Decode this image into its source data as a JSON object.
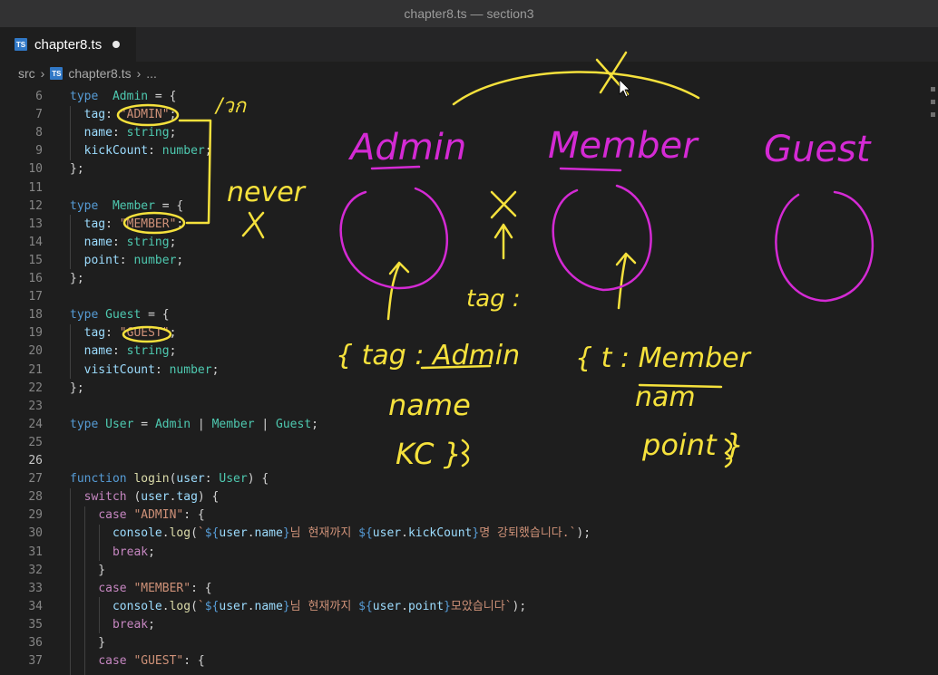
{
  "window": {
    "title": "chapter8.ts — section3"
  },
  "tab": {
    "badge": "TS",
    "label": "chapter8.ts"
  },
  "breadcrumb": {
    "folder": "src",
    "badge": "TS",
    "file": "chapter8.ts",
    "more": "..."
  },
  "colors": {
    "keyword": "#569cd6",
    "control": "#c586c0",
    "type": "#4ec9b0",
    "property": "#9cdcfe",
    "string": "#ce9178",
    "function": "#dcdcaa",
    "annotation_yellow": "#f5e13c",
    "annotation_magenta": "#d42ad4",
    "ts_badge": "#3178c6"
  },
  "annotations": {
    "labels": [
      "Admin",
      "Member",
      "Guest"
    ],
    "notes": [
      "/วก",
      "never",
      "X",
      "X",
      "tag :",
      "{ tag : Admin",
      "name",
      "KC }",
      "{ t : Member",
      "nam",
      "point }"
    ]
  },
  "code": {
    "lines": [
      {
        "no": "6",
        "tokens": [
          [
            "kw",
            "type"
          ],
          [
            "",
            "  "
          ],
          [
            "tp",
            "Admin"
          ],
          [
            "",
            " = {"
          ]
        ]
      },
      {
        "no": "7",
        "tokens": [
          [
            "",
            "  "
          ],
          [
            "pr",
            "tag"
          ],
          [
            "",
            ": "
          ],
          [
            "st",
            "\"ADMIN\""
          ],
          [
            "",
            ";"
          ]
        ]
      },
      {
        "no": "8",
        "tokens": [
          [
            "",
            "  "
          ],
          [
            "pr",
            "name"
          ],
          [
            "",
            ": "
          ],
          [
            "tp",
            "string"
          ],
          [
            "",
            ";"
          ]
        ]
      },
      {
        "no": "9",
        "tokens": [
          [
            "",
            "  "
          ],
          [
            "pr",
            "kickCount"
          ],
          [
            "",
            ": "
          ],
          [
            "tp",
            "number"
          ],
          [
            "",
            ";"
          ]
        ]
      },
      {
        "no": "10",
        "tokens": [
          [
            "",
            "};"
          ]
        ]
      },
      {
        "no": "11",
        "tokens": []
      },
      {
        "no": "12",
        "tokens": [
          [
            "kw",
            "type"
          ],
          [
            "",
            "  "
          ],
          [
            "tp",
            "Member"
          ],
          [
            "",
            " = {"
          ]
        ]
      },
      {
        "no": "13",
        "tokens": [
          [
            "",
            "  "
          ],
          [
            "pr",
            "tag"
          ],
          [
            "",
            ": "
          ],
          [
            "st",
            "\"MEMBER\""
          ],
          [
            "",
            ";"
          ]
        ]
      },
      {
        "no": "14",
        "tokens": [
          [
            "",
            "  "
          ],
          [
            "pr",
            "name"
          ],
          [
            "",
            ": "
          ],
          [
            "tp",
            "string"
          ],
          [
            "",
            ";"
          ]
        ]
      },
      {
        "no": "15",
        "tokens": [
          [
            "",
            "  "
          ],
          [
            "pr",
            "point"
          ],
          [
            "",
            ": "
          ],
          [
            "tp",
            "number"
          ],
          [
            "",
            ";"
          ]
        ]
      },
      {
        "no": "16",
        "tokens": [
          [
            "",
            "};"
          ]
        ]
      },
      {
        "no": "17",
        "tokens": []
      },
      {
        "no": "18",
        "tokens": [
          [
            "kw",
            "type"
          ],
          [
            "",
            " "
          ],
          [
            "tp",
            "Guest"
          ],
          [
            "",
            " = {"
          ]
        ]
      },
      {
        "no": "19",
        "tokens": [
          [
            "",
            "  "
          ],
          [
            "pr",
            "tag"
          ],
          [
            "",
            ": "
          ],
          [
            "st",
            "\"GUEST\""
          ],
          [
            "",
            ";"
          ]
        ]
      },
      {
        "no": "20",
        "tokens": [
          [
            "",
            "  "
          ],
          [
            "pr",
            "name"
          ],
          [
            "",
            ": "
          ],
          [
            "tp",
            "string"
          ],
          [
            "",
            ";"
          ]
        ]
      },
      {
        "no": "21",
        "tokens": [
          [
            "",
            "  "
          ],
          [
            "pr",
            "visitCount"
          ],
          [
            "",
            ": "
          ],
          [
            "tp",
            "number"
          ],
          [
            "",
            ";"
          ]
        ]
      },
      {
        "no": "22",
        "tokens": [
          [
            "",
            "};"
          ]
        ]
      },
      {
        "no": "23",
        "tokens": []
      },
      {
        "no": "24",
        "tokens": [
          [
            "kw",
            "type"
          ],
          [
            "",
            " "
          ],
          [
            "tp",
            "User"
          ],
          [
            "",
            " = "
          ],
          [
            "tp",
            "Admin"
          ],
          [
            "",
            " | "
          ],
          [
            "tp",
            "Member"
          ],
          [
            "",
            " | "
          ],
          [
            "tp",
            "Guest"
          ],
          [
            "",
            ";"
          ]
        ]
      },
      {
        "no": "25",
        "tokens": []
      },
      {
        "no": "26",
        "tokens": []
      },
      {
        "no": "27",
        "tokens": [
          [
            "kw",
            "function"
          ],
          [
            "",
            " "
          ],
          [
            "fn",
            "login"
          ],
          [
            "",
            "("
          ],
          [
            "pr",
            "user"
          ],
          [
            "",
            ": "
          ],
          [
            "tp",
            "User"
          ],
          [
            "",
            ") {"
          ]
        ]
      },
      {
        "no": "28",
        "tokens": [
          [
            "",
            "  "
          ],
          [
            "ctl",
            "switch"
          ],
          [
            "",
            " ("
          ],
          [
            "pr",
            "user"
          ],
          [
            "",
            "."
          ],
          [
            "pr",
            "tag"
          ],
          [
            "",
            ") {"
          ]
        ]
      },
      {
        "no": "29",
        "tokens": [
          [
            "",
            "    "
          ],
          [
            "ctl",
            "case"
          ],
          [
            "",
            " "
          ],
          [
            "st",
            "\"ADMIN\""
          ],
          [
            "",
            ": {"
          ]
        ]
      },
      {
        "no": "30",
        "tokens": [
          [
            "",
            "      "
          ],
          [
            "pr",
            "console"
          ],
          [
            "",
            "."
          ],
          [
            "fn",
            "log"
          ],
          [
            "",
            "("
          ],
          [
            "st",
            "`"
          ],
          [
            "tpl",
            "${"
          ],
          [
            "pr",
            "user"
          ],
          [
            "",
            "."
          ],
          [
            "pr",
            "name"
          ],
          [
            "tpl",
            "}"
          ],
          [
            "st",
            "님 현재까지 "
          ],
          [
            "tpl",
            "${"
          ],
          [
            "pr",
            "user"
          ],
          [
            "",
            "."
          ],
          [
            "pr",
            "kickCount"
          ],
          [
            "tpl",
            "}"
          ],
          [
            "st",
            "명 강퇴했습니다.`"
          ],
          [
            "",
            ");"
          ]
        ]
      },
      {
        "no": "31",
        "tokens": [
          [
            "",
            "      "
          ],
          [
            "ctl",
            "break"
          ],
          [
            "",
            ";"
          ]
        ]
      },
      {
        "no": "32",
        "tokens": [
          [
            "",
            "    }"
          ]
        ]
      },
      {
        "no": "33",
        "tokens": [
          [
            "",
            "    "
          ],
          [
            "ctl",
            "case"
          ],
          [
            "",
            " "
          ],
          [
            "st",
            "\"MEMBER\""
          ],
          [
            "",
            ": {"
          ]
        ]
      },
      {
        "no": "34",
        "tokens": [
          [
            "",
            "      "
          ],
          [
            "pr",
            "console"
          ],
          [
            "",
            "."
          ],
          [
            "fn",
            "log"
          ],
          [
            "",
            "("
          ],
          [
            "st",
            "`"
          ],
          [
            "tpl",
            "${"
          ],
          [
            "pr",
            "user"
          ],
          [
            "",
            "."
          ],
          [
            "pr",
            "name"
          ],
          [
            "tpl",
            "}"
          ],
          [
            "st",
            "님 현재까지 "
          ],
          [
            "tpl",
            "${"
          ],
          [
            "pr",
            "user"
          ],
          [
            "",
            "."
          ],
          [
            "pr",
            "point"
          ],
          [
            "tpl",
            "}"
          ],
          [
            "st",
            "모았습니다`"
          ],
          [
            "",
            ");"
          ]
        ]
      },
      {
        "no": "35",
        "tokens": [
          [
            "",
            "      "
          ],
          [
            "ctl",
            "break"
          ],
          [
            "",
            ";"
          ]
        ]
      },
      {
        "no": "36",
        "tokens": [
          [
            "",
            "    }"
          ]
        ]
      },
      {
        "no": "37",
        "tokens": [
          [
            "",
            "    "
          ],
          [
            "ctl",
            "case"
          ],
          [
            "",
            " "
          ],
          [
            "st",
            "\"GUEST\""
          ],
          [
            "",
            ": {"
          ]
        ]
      }
    ],
    "active_line": "26"
  }
}
